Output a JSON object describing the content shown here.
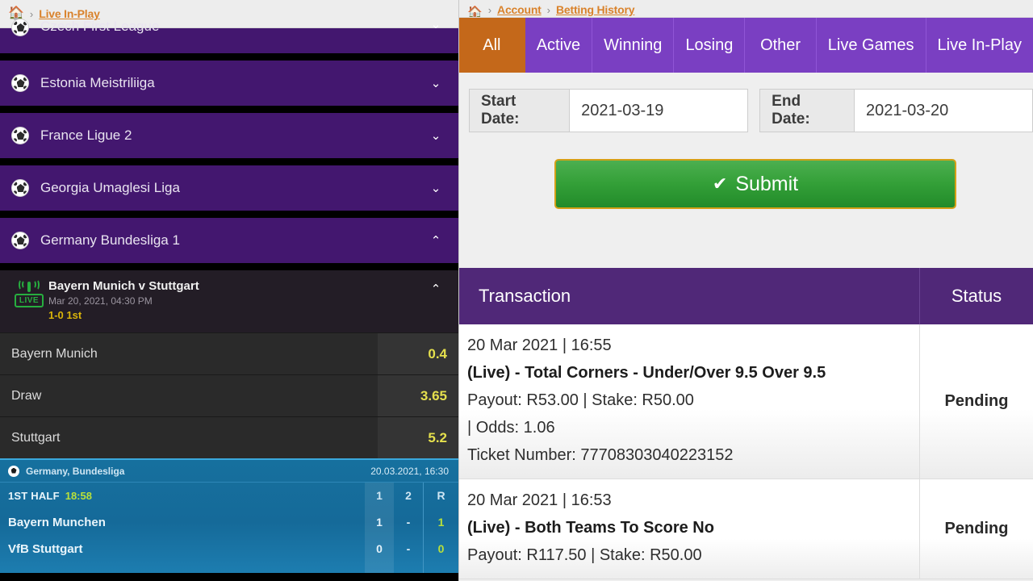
{
  "left": {
    "breadcrumb": {
      "home_icon": "home-icon",
      "separator": "›",
      "link": "Live In-Play"
    },
    "leagues": [
      {
        "name": "Czech First League",
        "chevron": "⌄",
        "expanded": false,
        "clipped": true
      },
      {
        "name": "Estonia Meistriliiga",
        "chevron": "⌄",
        "expanded": false,
        "clipped": false
      },
      {
        "name": "France Ligue 2",
        "chevron": "⌄",
        "expanded": false,
        "clipped": false
      },
      {
        "name": "Georgia Umaglesi Liga",
        "chevron": "⌄",
        "expanded": false,
        "clipped": false
      },
      {
        "name": "Germany Bundesliga 1",
        "chevron": "⌃",
        "expanded": true,
        "clipped": false
      }
    ],
    "match": {
      "live_badge": "LIVE",
      "title": "Bayern Munich v Stuttgart",
      "datetime": "Mar 20, 2021, 04:30 PM",
      "score": "1-0 1st",
      "chevron": "⌃",
      "selections": [
        {
          "name": "Bayern Munich",
          "odds": "0.4"
        },
        {
          "name": "Draw",
          "odds": "3.65"
        },
        {
          "name": "Stuttgart",
          "odds": "5.2"
        }
      ]
    },
    "live_widget": {
      "league": "Germany, Bundesliga",
      "datetime": "20.03.2021, 16:30",
      "period": "1ST HALF",
      "clock": "18:58",
      "columns": [
        "1",
        "2",
        "R"
      ],
      "rows": [
        {
          "team": "Bayern Munchen",
          "c1": "1",
          "c2": "-",
          "r": "1"
        },
        {
          "team": "VfB Stuttgart",
          "c1": "0",
          "c2": "-",
          "r": "0"
        }
      ]
    }
  },
  "right": {
    "breadcrumb": {
      "home_icon": "home-icon",
      "separator": "›",
      "link1": "Account",
      "link2": "Betting History"
    },
    "tabs": [
      {
        "label": "All",
        "active": true
      },
      {
        "label": "Active",
        "active": false
      },
      {
        "label": "Winning",
        "active": false
      },
      {
        "label": "Losing",
        "active": false
      },
      {
        "label": "Other",
        "active": false
      },
      {
        "label": "Live Games",
        "active": false
      },
      {
        "label": "Live In-Play",
        "active": false
      }
    ],
    "filters": {
      "start_label": "Start Date:",
      "start_value": "2021-03-19",
      "end_label": "End Date:",
      "end_value": "2021-03-20",
      "submit_label": "Submit",
      "submit_icon": "✔"
    },
    "table": {
      "headers": {
        "transaction": "Transaction",
        "status": "Status"
      },
      "rows": [
        {
          "date": "20 Mar 2021 | 16:55",
          "title": "(Live) - Total Corners - Under/Over 9.5 Over 9.5",
          "payout": "Payout: R53.00 | Stake: R50.00",
          "odds": " | Odds: 1.06",
          "ticket": "Ticket Number: 77708303040223152",
          "status": "Pending"
        },
        {
          "date": "20 Mar 2021 | 16:53",
          "title": "(Live) - Both Teams To Score No",
          "payout": "Payout: R117.50 | Stake: R50.00",
          "odds": "",
          "ticket": "",
          "status": "Pending"
        }
      ]
    }
  },
  "colors": {
    "league_purple": "#43176f",
    "tab_purple": "#7a3fc2",
    "tab_active_orange": "#c4681a",
    "table_header_purple": "#502878",
    "odds_yellow": "#e5e04d",
    "submit_green": "#34a038",
    "submit_border_gold": "#d4a017",
    "live_green": "#27ae3f",
    "widget_blue": "#16709e",
    "breadcrumb_orange": "#d9822b"
  }
}
